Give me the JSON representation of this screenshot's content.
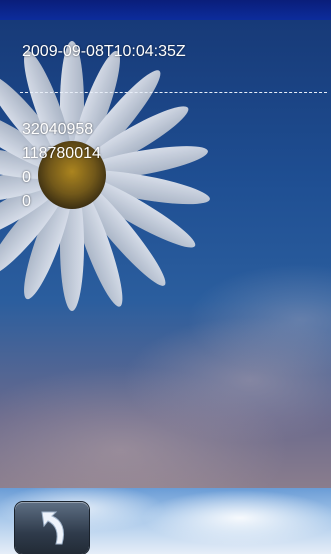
{
  "screen": {
    "timestamp": "2009-09-08T10:04:35Z",
    "values": [
      "32040958",
      "118780014",
      "0",
      "0"
    ]
  },
  "icons": {
    "back": "back-arrow-icon"
  },
  "colors": {
    "top_bar": "#0c2c9c",
    "text": "#ffffff",
    "button": "#3a4656"
  }
}
